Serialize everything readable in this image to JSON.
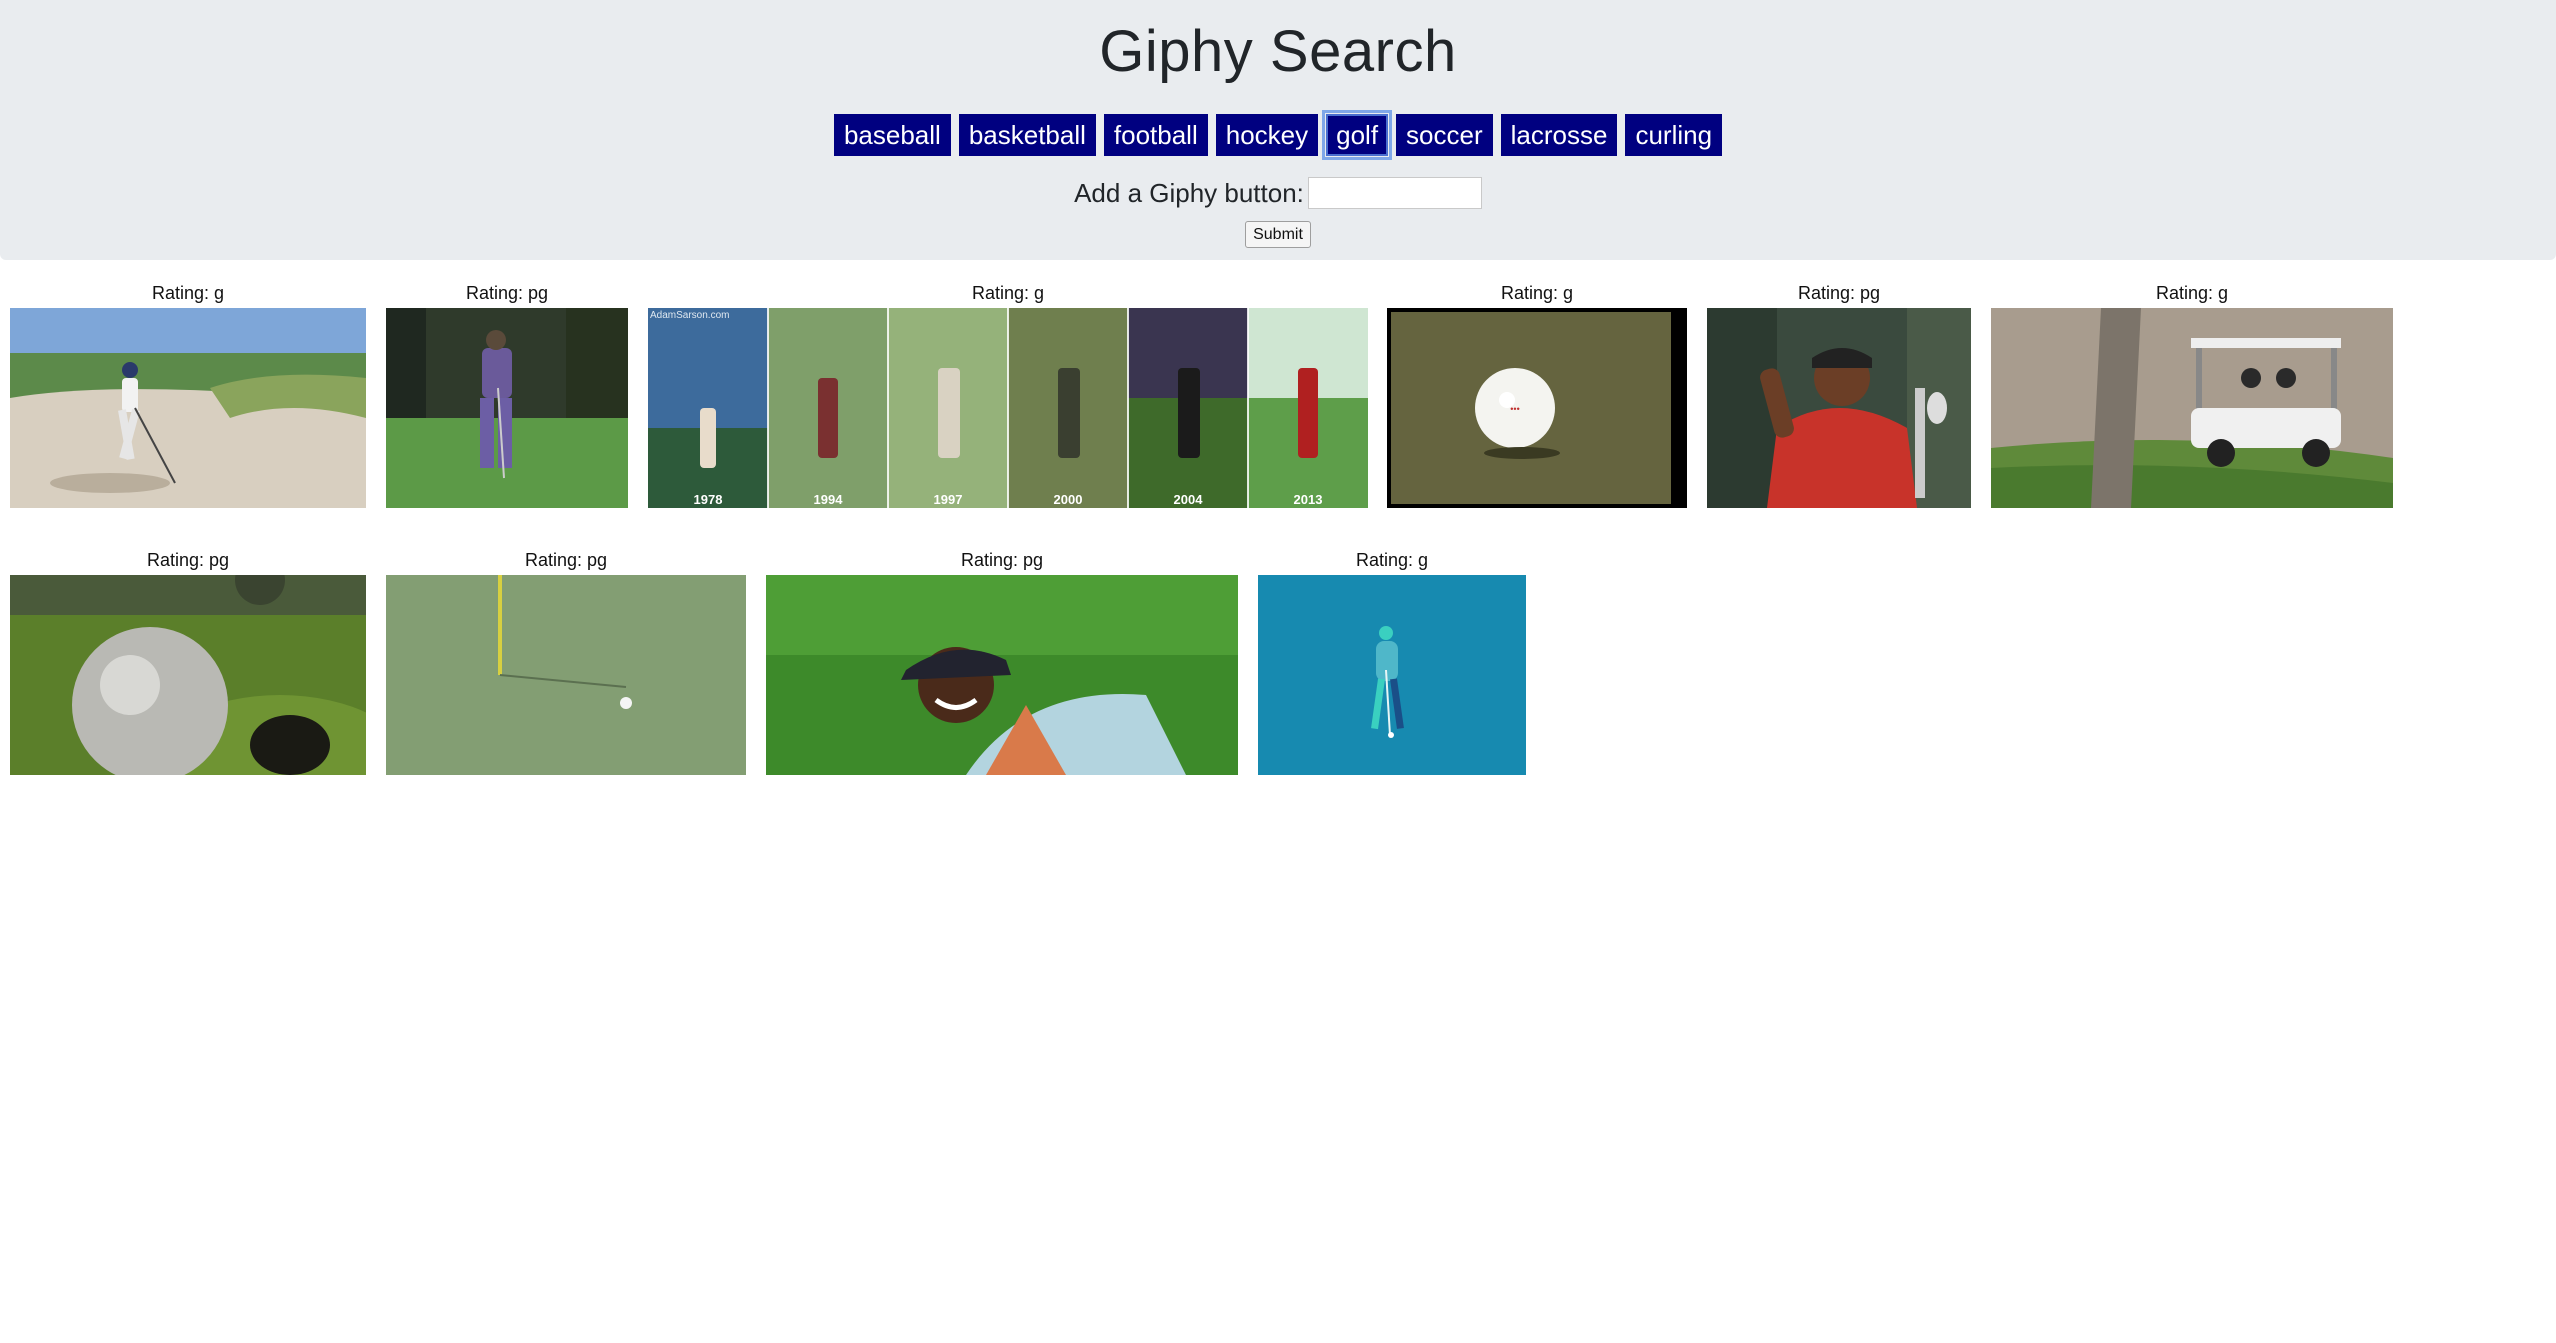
{
  "header": {
    "title": "Giphy Search",
    "topics": [
      "baseball",
      "basketball",
      "football",
      "hockey",
      "golf",
      "soccer",
      "lacrosse",
      "curling"
    ],
    "focused_topic": "golf",
    "add_label": "Add a Giphy button:",
    "add_input_value": "",
    "submit_label": "Submit"
  },
  "gifs": [
    {
      "rating": "Rating: g",
      "icon": "golfer-in-bunker-image"
    },
    {
      "rating": "Rating: pg",
      "icon": "golfer-plaid-pants-image"
    },
    {
      "rating": "Rating: g",
      "icon": "swing-evolution-collage-image",
      "years": [
        "1978",
        "1994",
        "1997",
        "2000",
        "2004",
        "2013"
      ],
      "watermark": "AdamSarson.com"
    },
    {
      "rating": "Rating: g",
      "icon": "golf-ball-on-grass-image"
    },
    {
      "rating": "Rating: pg",
      "icon": "golfer-celebrating-image"
    },
    {
      "rating": "Rating: g",
      "icon": "golf-cart-image"
    },
    {
      "rating": "Rating: pg",
      "icon": "ball-rolling-into-cup-image"
    },
    {
      "rating": "Rating: pg",
      "icon": "ball-near-flagstick-image"
    },
    {
      "rating": "Rating: pg",
      "icon": "smiling-golfer-image"
    },
    {
      "rating": "Rating: g",
      "icon": "animated-golfer-illustration-image"
    }
  ],
  "colors": {
    "button_bg": "#000080",
    "jumbotron_bg": "#e9ecef",
    "focus_ring": "#7fa7e8"
  }
}
